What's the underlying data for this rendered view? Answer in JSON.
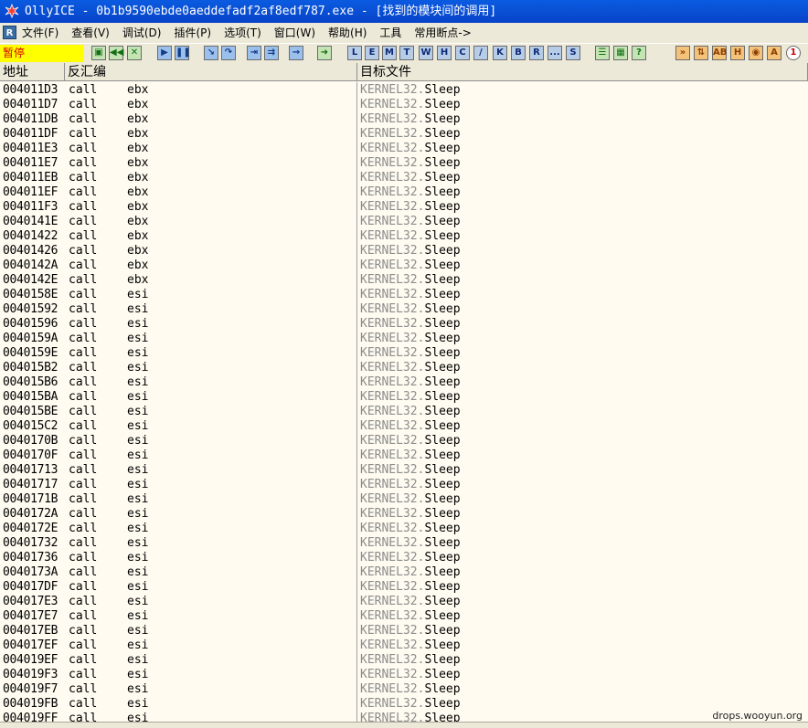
{
  "window": {
    "title": "OllyICE - 0b1b9590ebde0aeddefadf2af8edf787.exe - [找到的模块间的调用]"
  },
  "menu": [
    "文件(F)",
    "查看(V)",
    "调试(D)",
    "插件(P)",
    "选项(T)",
    "窗口(W)",
    "帮助(H)",
    "工具",
    "常用断点->"
  ],
  "toolbar": {
    "status": "暂停",
    "letters": [
      "L",
      "E",
      "M",
      "T",
      "W",
      "H",
      "C",
      "/",
      "K",
      "B",
      "R",
      "...",
      "S"
    ]
  },
  "columns": {
    "address": "地址",
    "disasm": "反汇编",
    "target": "目标文件"
  },
  "rows": [
    {
      "addr": "004011D3",
      "mn": "call",
      "op": "ebx",
      "mod": "KERNEL32.",
      "fn": "Sleep"
    },
    {
      "addr": "004011D7",
      "mn": "call",
      "op": "ebx",
      "mod": "KERNEL32.",
      "fn": "Sleep"
    },
    {
      "addr": "004011DB",
      "mn": "call",
      "op": "ebx",
      "mod": "KERNEL32.",
      "fn": "Sleep"
    },
    {
      "addr": "004011DF",
      "mn": "call",
      "op": "ebx",
      "mod": "KERNEL32.",
      "fn": "Sleep"
    },
    {
      "addr": "004011E3",
      "mn": "call",
      "op": "ebx",
      "mod": "KERNEL32.",
      "fn": "Sleep"
    },
    {
      "addr": "004011E7",
      "mn": "call",
      "op": "ebx",
      "mod": "KERNEL32.",
      "fn": "Sleep"
    },
    {
      "addr": "004011EB",
      "mn": "call",
      "op": "ebx",
      "mod": "KERNEL32.",
      "fn": "Sleep"
    },
    {
      "addr": "004011EF",
      "mn": "call",
      "op": "ebx",
      "mod": "KERNEL32.",
      "fn": "Sleep"
    },
    {
      "addr": "004011F3",
      "mn": "call",
      "op": "ebx",
      "mod": "KERNEL32.",
      "fn": "Sleep"
    },
    {
      "addr": "0040141E",
      "mn": "call",
      "op": "ebx",
      "mod": "KERNEL32.",
      "fn": "Sleep"
    },
    {
      "addr": "00401422",
      "mn": "call",
      "op": "ebx",
      "mod": "KERNEL32.",
      "fn": "Sleep"
    },
    {
      "addr": "00401426",
      "mn": "call",
      "op": "ebx",
      "mod": "KERNEL32.",
      "fn": "Sleep"
    },
    {
      "addr": "0040142A",
      "mn": "call",
      "op": "ebx",
      "mod": "KERNEL32.",
      "fn": "Sleep"
    },
    {
      "addr": "0040142E",
      "mn": "call",
      "op": "ebx",
      "mod": "KERNEL32.",
      "fn": "Sleep"
    },
    {
      "addr": "0040158E",
      "mn": "call",
      "op": "esi",
      "mod": "KERNEL32.",
      "fn": "Sleep"
    },
    {
      "addr": "00401592",
      "mn": "call",
      "op": "esi",
      "mod": "KERNEL32.",
      "fn": "Sleep"
    },
    {
      "addr": "00401596",
      "mn": "call",
      "op": "esi",
      "mod": "KERNEL32.",
      "fn": "Sleep"
    },
    {
      "addr": "0040159A",
      "mn": "call",
      "op": "esi",
      "mod": "KERNEL32.",
      "fn": "Sleep"
    },
    {
      "addr": "0040159E",
      "mn": "call",
      "op": "esi",
      "mod": "KERNEL32.",
      "fn": "Sleep"
    },
    {
      "addr": "004015B2",
      "mn": "call",
      "op": "esi",
      "mod": "KERNEL32.",
      "fn": "Sleep"
    },
    {
      "addr": "004015B6",
      "mn": "call",
      "op": "esi",
      "mod": "KERNEL32.",
      "fn": "Sleep"
    },
    {
      "addr": "004015BA",
      "mn": "call",
      "op": "esi",
      "mod": "KERNEL32.",
      "fn": "Sleep"
    },
    {
      "addr": "004015BE",
      "mn": "call",
      "op": "esi",
      "mod": "KERNEL32.",
      "fn": "Sleep"
    },
    {
      "addr": "004015C2",
      "mn": "call",
      "op": "esi",
      "mod": "KERNEL32.",
      "fn": "Sleep"
    },
    {
      "addr": "0040170B",
      "mn": "call",
      "op": "esi",
      "mod": "KERNEL32.",
      "fn": "Sleep"
    },
    {
      "addr": "0040170F",
      "mn": "call",
      "op": "esi",
      "mod": "KERNEL32.",
      "fn": "Sleep"
    },
    {
      "addr": "00401713",
      "mn": "call",
      "op": "esi",
      "mod": "KERNEL32.",
      "fn": "Sleep"
    },
    {
      "addr": "00401717",
      "mn": "call",
      "op": "esi",
      "mod": "KERNEL32.",
      "fn": "Sleep"
    },
    {
      "addr": "0040171B",
      "mn": "call",
      "op": "esi",
      "mod": "KERNEL32.",
      "fn": "Sleep"
    },
    {
      "addr": "0040172A",
      "mn": "call",
      "op": "esi",
      "mod": "KERNEL32.",
      "fn": "Sleep"
    },
    {
      "addr": "0040172E",
      "mn": "call",
      "op": "esi",
      "mod": "KERNEL32.",
      "fn": "Sleep"
    },
    {
      "addr": "00401732",
      "mn": "call",
      "op": "esi",
      "mod": "KERNEL32.",
      "fn": "Sleep"
    },
    {
      "addr": "00401736",
      "mn": "call",
      "op": "esi",
      "mod": "KERNEL32.",
      "fn": "Sleep"
    },
    {
      "addr": "0040173A",
      "mn": "call",
      "op": "esi",
      "mod": "KERNEL32.",
      "fn": "Sleep"
    },
    {
      "addr": "004017DF",
      "mn": "call",
      "op": "esi",
      "mod": "KERNEL32.",
      "fn": "Sleep"
    },
    {
      "addr": "004017E3",
      "mn": "call",
      "op": "esi",
      "mod": "KERNEL32.",
      "fn": "Sleep"
    },
    {
      "addr": "004017E7",
      "mn": "call",
      "op": "esi",
      "mod": "KERNEL32.",
      "fn": "Sleep"
    },
    {
      "addr": "004017EB",
      "mn": "call",
      "op": "esi",
      "mod": "KERNEL32.",
      "fn": "Sleep"
    },
    {
      "addr": "004017EF",
      "mn": "call",
      "op": "esi",
      "mod": "KERNEL32.",
      "fn": "Sleep"
    },
    {
      "addr": "004019EF",
      "mn": "call",
      "op": "esi",
      "mod": "KERNEL32.",
      "fn": "Sleep"
    },
    {
      "addr": "004019F3",
      "mn": "call",
      "op": "esi",
      "mod": "KERNEL32.",
      "fn": "Sleep"
    },
    {
      "addr": "004019F7",
      "mn": "call",
      "op": "esi",
      "mod": "KERNEL32.",
      "fn": "Sleep"
    },
    {
      "addr": "004019FB",
      "mn": "call",
      "op": "esi",
      "mod": "KERNEL32.",
      "fn": "Sleep"
    },
    {
      "addr": "004019FF",
      "mn": "call",
      "op": "esi",
      "mod": "KERNEL32.",
      "fn": "Sleep"
    }
  ],
  "watermark": "drops.wooyun.org"
}
